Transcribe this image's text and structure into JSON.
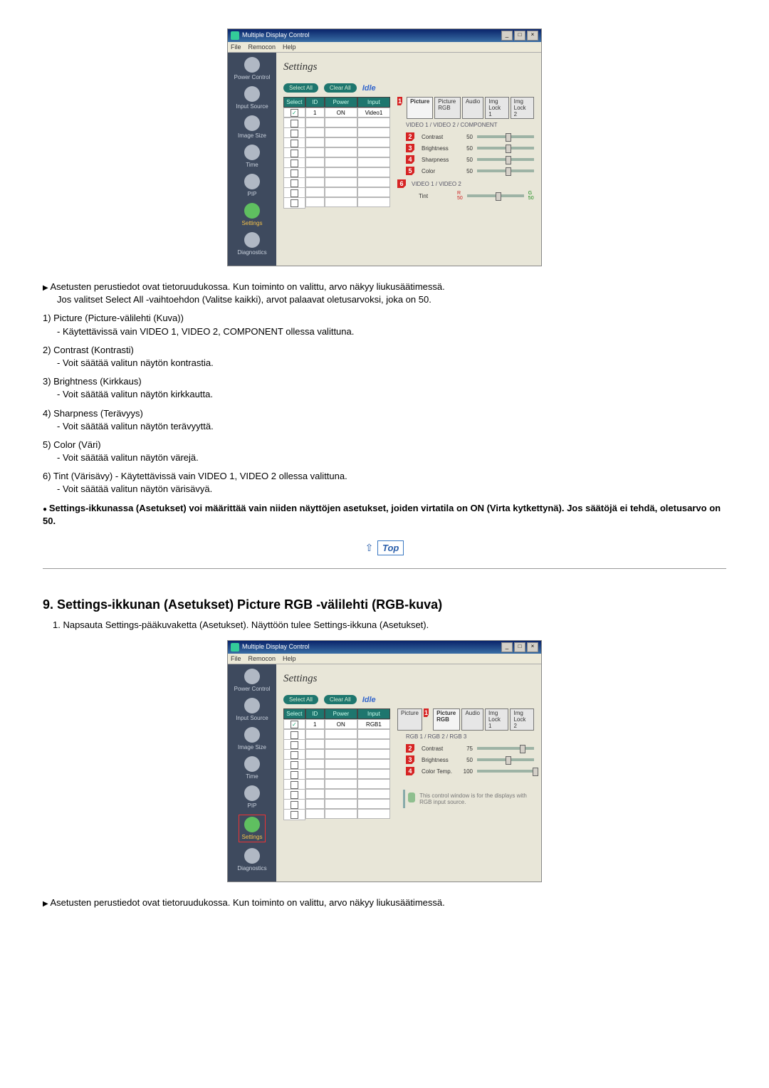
{
  "window": {
    "title": "Multiple Display Control",
    "menus": [
      "File",
      "Remocon",
      "Help"
    ]
  },
  "sidebar": {
    "items": [
      {
        "label": "Power Control"
      },
      {
        "label": "Input Source"
      },
      {
        "label": "Image Size"
      },
      {
        "label": "Time"
      },
      {
        "label": "PIP"
      },
      {
        "label": "Settings"
      },
      {
        "label": "Diagnostics"
      }
    ]
  },
  "content": {
    "title": "Settings",
    "select_all": "Select All",
    "clear_all": "Clear All",
    "idle_label": "Idle",
    "grid": {
      "headers": {
        "select": "Select",
        "id": "ID",
        "power": "Power",
        "input": "Input"
      },
      "row1": {
        "id": "1",
        "power": "ON",
        "input_v": "Video1",
        "input_r": "RGB1"
      }
    },
    "tabs_picture": {
      "t1": "Picture",
      "t2": "Picture RGB",
      "t3": "Audio",
      "t4": "Img Lock 1",
      "t5": "Img Lock 2"
    },
    "group_video": "VIDEO 1 / VIDEO 2 / COMPONENT",
    "group_video2": "VIDEO 1 / VIDEO 2",
    "sliders_picture": {
      "contrast": {
        "label": "Contrast",
        "value": "50"
      },
      "brightness": {
        "label": "Brightness",
        "value": "50"
      },
      "sharpness": {
        "label": "Sharpness",
        "value": "50"
      },
      "color": {
        "label": "Color",
        "value": "50"
      },
      "tint": {
        "label": "Tint",
        "valueR": "R\n50",
        "valueG": "G\n50"
      }
    },
    "tabs_rgb": {
      "t1": "Picture",
      "t2": "Picture RGB",
      "t3": "Audio",
      "t4": "Img Lock 1",
      "t5": "Img Lock 2"
    },
    "group_rgb": "RGB 1 / RGB 2 / RGB 3",
    "sliders_rgb": {
      "contrast": {
        "label": "Contrast",
        "value": "75"
      },
      "brightness": {
        "label": "Brightness",
        "value": "50"
      },
      "colortemp": {
        "label": "Color Temp.",
        "value": "100"
      }
    },
    "info_msg": "This control window is for the displays with RGB input source."
  },
  "notes1": {
    "bullet1": "Asetusten perustiedot ovat tietoruudukossa. Kun toiminto on valittu, arvo näkyy liukusäätimessä.",
    "bullet1b": "Jos valitset Select All -vaihtoehdon (Valitse kaikki), arvot palaavat oletusarvoksi, joka on 50.",
    "n1": "1) Picture (Picture-välilehti (Kuva))",
    "n1s": "- Käytettävissä vain VIDEO 1, VIDEO 2, COMPONENT ollessa valittuna.",
    "n2": "2) Contrast (Kontrasti)",
    "n2s": "- Voit säätää valitun näytön kontrastia.",
    "n3": "3) Brightness (Kirkkaus)",
    "n3s": "- Voit säätää valitun näytön kirkkautta.",
    "n4": "4) Sharpness (Terävyys)",
    "n4s": "- Voit säätää valitun näytön terävyyttä.",
    "n5": "5) Color (Väri)",
    "n5s": "- Voit säätää valitun näytön värejä.",
    "n6": "6) Tint (Värisävy) - Käytettävissä vain VIDEO 1, VIDEO 2  ollessa valittuna.",
    "n6s": "- Voit säätää valitun näytön värisävyä.",
    "bold1": "Settings-ikkunassa (Asetukset) voi määrittää vain niiden näyttöjen asetukset, joiden virtatila on ON (Virta kytkettynä). Jos säätöjä ei tehdä, oletusarvo on 50."
  },
  "top_label": "Top",
  "section2": {
    "heading": "9. Settings-ikkunan (Asetukset) Picture RGB -välilehti (RGB-kuva)",
    "step1": "1. Napsauta Settings-pääkuvaketta (Asetukset). Näyttöön tulee Settings-ikkuna (Asetukset)."
  },
  "notes2": {
    "bullet1": "Asetusten perustiedot ovat tietoruudukossa. Kun toiminto on valittu, arvo näkyy liukusäätimessä."
  }
}
